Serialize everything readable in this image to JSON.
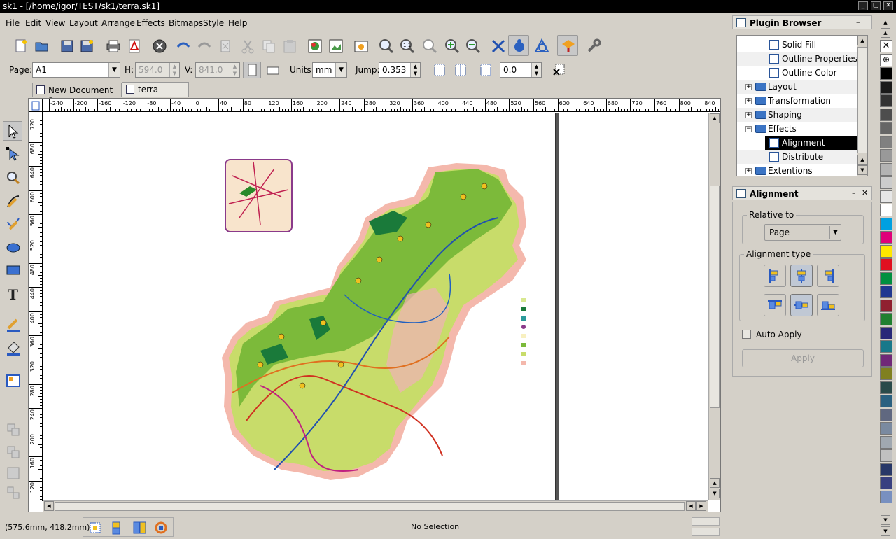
{
  "window": {
    "title": "sk1 - [/home/igor/TEST/sk1/terra.sk1]"
  },
  "menu": [
    "File",
    "Edit",
    "View",
    "Layout",
    "Arrange",
    "Effects",
    "Bitmaps",
    "Style",
    "Help"
  ],
  "toolbar": {
    "icons": [
      "new-document",
      "open",
      "save",
      "save-as",
      "print",
      "export-pdf",
      "close-document",
      "undo",
      "redo",
      "clear",
      "cut",
      "copy",
      "paste",
      "import-image",
      "export-bitmap",
      "properties",
      "zoom-in",
      "zoom-1-1",
      "zoom-fit",
      "zoom-plus",
      "zoom-minus",
      "cross-snap",
      "snap-guides",
      "snap-objects",
      "color-picker",
      "plugins"
    ]
  },
  "props": {
    "page_label": "Page:",
    "page_value": "A1",
    "h_label": "H:",
    "h_value": "594.0",
    "v_label": "V:",
    "v_value": "841.0",
    "units_label": "Units:",
    "units_value": "mm",
    "jump_label": "Jump:",
    "jump_value": "0.353",
    "offset_value": "0.0"
  },
  "tabs": [
    {
      "label": "New Document 1"
    },
    {
      "label": "terra"
    }
  ],
  "ruler": {
    "h_ticks": [
      "-240",
      "-200",
      "-160",
      "-120",
      "-80",
      "-40",
      "0",
      "40",
      "80",
      "120",
      "160",
      "200",
      "240",
      "280",
      "320",
      "360",
      "400",
      "440",
      "480",
      "520",
      "560",
      "600",
      "640",
      "680",
      "720",
      "760",
      "800",
      "840"
    ],
    "v_ticks": [
      "720",
      "680",
      "640",
      "600",
      "560",
      "520",
      "480",
      "440",
      "400",
      "360",
      "320",
      "280",
      "240",
      "200",
      "160",
      "120",
      "80",
      "40"
    ]
  },
  "status": {
    "coords": "(575.6mm, 418.2mm)",
    "selection": "No Selection"
  },
  "plugin_browser": {
    "title": "Plugin Browser",
    "items": [
      {
        "label": "Solid Fill"
      },
      {
        "label": "Outline Properties"
      },
      {
        "label": "Outline Color"
      },
      {
        "label": "Layout"
      },
      {
        "label": "Transformation"
      },
      {
        "label": "Shaping"
      },
      {
        "label": "Effects"
      },
      {
        "label": "Alignment"
      },
      {
        "label": "Distribute"
      },
      {
        "label": "Extentions"
      }
    ]
  },
  "alignment": {
    "title": "Alignment",
    "relative_to_label": "Relative to",
    "relative_to_value": "Page",
    "type_label": "Alignment type",
    "auto_apply_label": "Auto Apply",
    "apply_label": "Apply"
  },
  "palette": {
    "colors": [
      "#000000",
      "#1a1a1a",
      "#333333",
      "#4d4d4d",
      "#666666",
      "#808080",
      "#999999",
      "#b3b3b3",
      "#cccccc",
      "#e6e6e6",
      "#ffffff",
      "#00a0e0",
      "#e0007a",
      "#ffe800",
      "#e01020",
      "#009040",
      "#203890",
      "#902030",
      "#208030",
      "#282878",
      "#18788a",
      "#702878",
      "#808020",
      "#2a4a4a",
      "#2a6080",
      "#606880",
      "#7a8aa0",
      "#a0a8b0",
      "#c0c0c0",
      "#283868",
      "#384080",
      "#7890c0"
    ]
  }
}
